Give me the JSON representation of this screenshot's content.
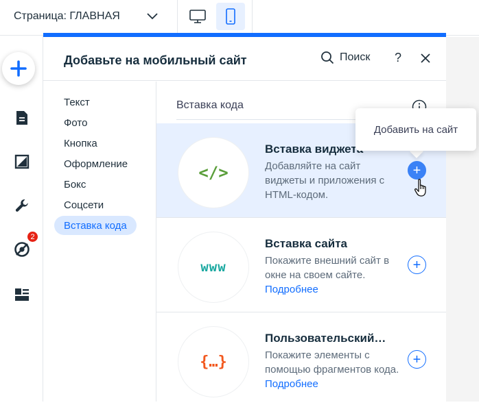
{
  "topbar": {
    "page_label": "Страница: ГЛАВНАЯ"
  },
  "rail": {
    "badge_count": "2"
  },
  "panel": {
    "title": "Добавьте на мобильный сайт",
    "search_label": "Поиск",
    "help_label": "?"
  },
  "categories": [
    {
      "label": "Текст"
    },
    {
      "label": "Фото"
    },
    {
      "label": "Кнопка"
    },
    {
      "label": "Оформление"
    },
    {
      "label": "Бокс"
    },
    {
      "label": "Соцсети"
    },
    {
      "label": "Вставка кода"
    }
  ],
  "section": {
    "title": "Вставка кода"
  },
  "items": [
    {
      "title": "Вставка виджета",
      "description": "Добавляйте на сайт виджеты и приложения с HTML-кодом.",
      "icon_text": "</>",
      "icon_color": "#5a9e3a"
    },
    {
      "title": "Вставка сайта",
      "description": "Покажите внешний сайт в окне на своем сайте.",
      "more": "Подробнее",
      "icon_text": "www",
      "icon_color": "#1aa8a0"
    },
    {
      "title": "Пользовательский…",
      "description": "Покажите элементы с помощью фрагментов кода.",
      "more": "Подробнее",
      "icon_text": "{…}",
      "icon_color": "#f2581e"
    }
  ],
  "tooltip": {
    "text": "Добавить на сайт"
  },
  "colors": {
    "accent": "#116dff",
    "badge": "#e62214"
  }
}
